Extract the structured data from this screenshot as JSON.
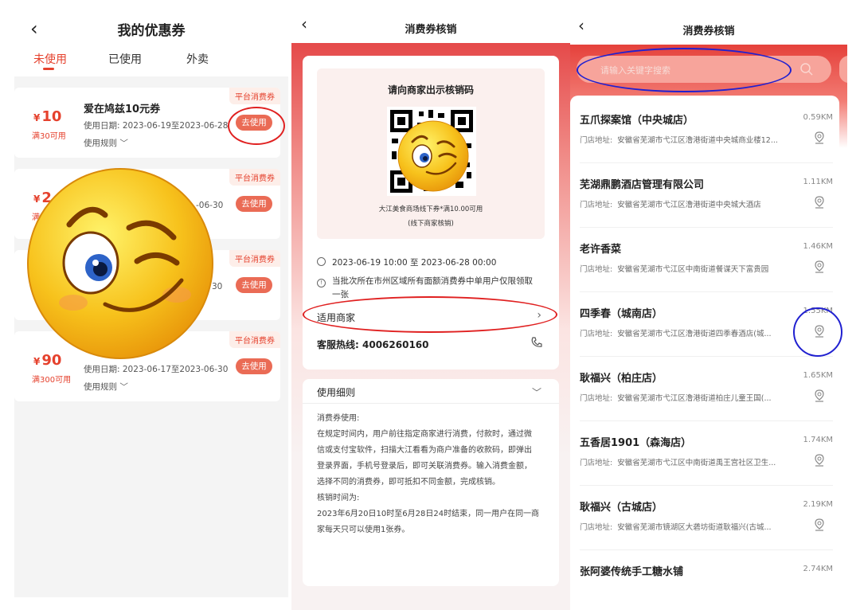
{
  "panel1": {
    "title": "我的优惠券",
    "tabs": [
      "未使用",
      "已使用",
      "外卖"
    ],
    "coupons": [
      {
        "symbol": "¥",
        "amount": "10",
        "min": "满30可用",
        "name": "爱在鸠兹10元券",
        "date": "使用日期: 2023-06-19至2023-06-28",
        "rule": "使用规则 ﹀",
        "tag": "平台消费券",
        "button": "去使用"
      },
      {
        "symbol": "¥",
        "amount": "2",
        "min": "满",
        "name": "",
        "date": "-06-30",
        "rule": "",
        "tag": "平台消费券",
        "button": "去使用"
      },
      {
        "symbol": "",
        "amount": "",
        "min": "",
        "name": "",
        "date": "30",
        "rule": "",
        "tag": "平台消费券",
        "button": "去使用"
      },
      {
        "symbol": "¥",
        "amount": "90",
        "min": "满300可用",
        "name": "",
        "date": "使用日期: 2023-06-17至2023-06-30",
        "rule": "使用规则 ﹀",
        "tag": "平台消费券",
        "button": "去使用"
      }
    ]
  },
  "panel2": {
    "title": "消费券核销",
    "qr_title": "请向商家出示核销码",
    "qr_note": "大江美食商场线下券*满10.00可用",
    "qr_note2": "(线下商家核销)",
    "time": "2023-06-19 10:00 至 2023-06-28 00:00",
    "notice_line1": "当批次所在市州区域所有面额消费券中单用户仅限领取",
    "notice_line2": "一张",
    "merchant_label": "适用商家",
    "hotline_label": "客服热线:",
    "hotline_number": "4006260160",
    "detail_title": "使用细则",
    "detail_lines": [
      "消费券使用:",
      "在规定时间内，用户前往指定商家进行消费，付款时，通过微",
      "信或支付宝软件，扫描大江看看为商户准备的收款码，即弹出",
      "登录界面，手机号登录后，即可关联消费券。输入消费金额，",
      "选择不同的消费券，即可抵扣不同金额，完成核销。",
      "核销时间为:",
      "2023年6月20日10时至6月28日24时结束，同一用户在同一商",
      "家每天只可以使用1张券。"
    ]
  },
  "panel3": {
    "title": "消费券核销",
    "search_placeholder": "请输入关键字搜索",
    "address_label": "门店地址:",
    "stores": [
      {
        "name": "五爪探案馆（中央城店）",
        "distance": "0.59KM",
        "address": "安徽省芜湖市弋江区澛港街道中央城商业楼12..."
      },
      {
        "name": "芜湖鼎鹏酒店管理有限公司",
        "distance": "1.11KM",
        "address": "安徽省芜湖市弋江区澛港街道中央城大酒店"
      },
      {
        "name": "老许香菜",
        "distance": "1.46KM",
        "address": "安徽省芜湖市弋江区中南街道餐谋天下富贵园"
      },
      {
        "name": "四季春（城南店）",
        "distance": "1.55KM",
        "address": "安徽省芜湖市弋江区澛港街道四季春酒店(城..."
      },
      {
        "name": "耿福兴（柏庄店）",
        "distance": "1.65KM",
        "address": "安徽省芜湖市弋江区澛港街道柏庄儿童王国(..."
      },
      {
        "name": "五香居1901（森海店）",
        "distance": "1.74KM",
        "address": "安徽省芜湖市弋江区中南街道禹王宫社区卫生..."
      },
      {
        "name": "耿福兴（古城店）",
        "distance": "2.19KM",
        "address": "安徽省芜湖市镜湖区大砻坊街道耿福兴(古城..."
      },
      {
        "name": "张阿婆传统手工糖水铺",
        "distance": "2.74KM",
        "address": ""
      }
    ]
  },
  "colors": {
    "accent": "#e5412d",
    "annotation_red": "#e02020",
    "annotation_blue": "#2020d0"
  }
}
